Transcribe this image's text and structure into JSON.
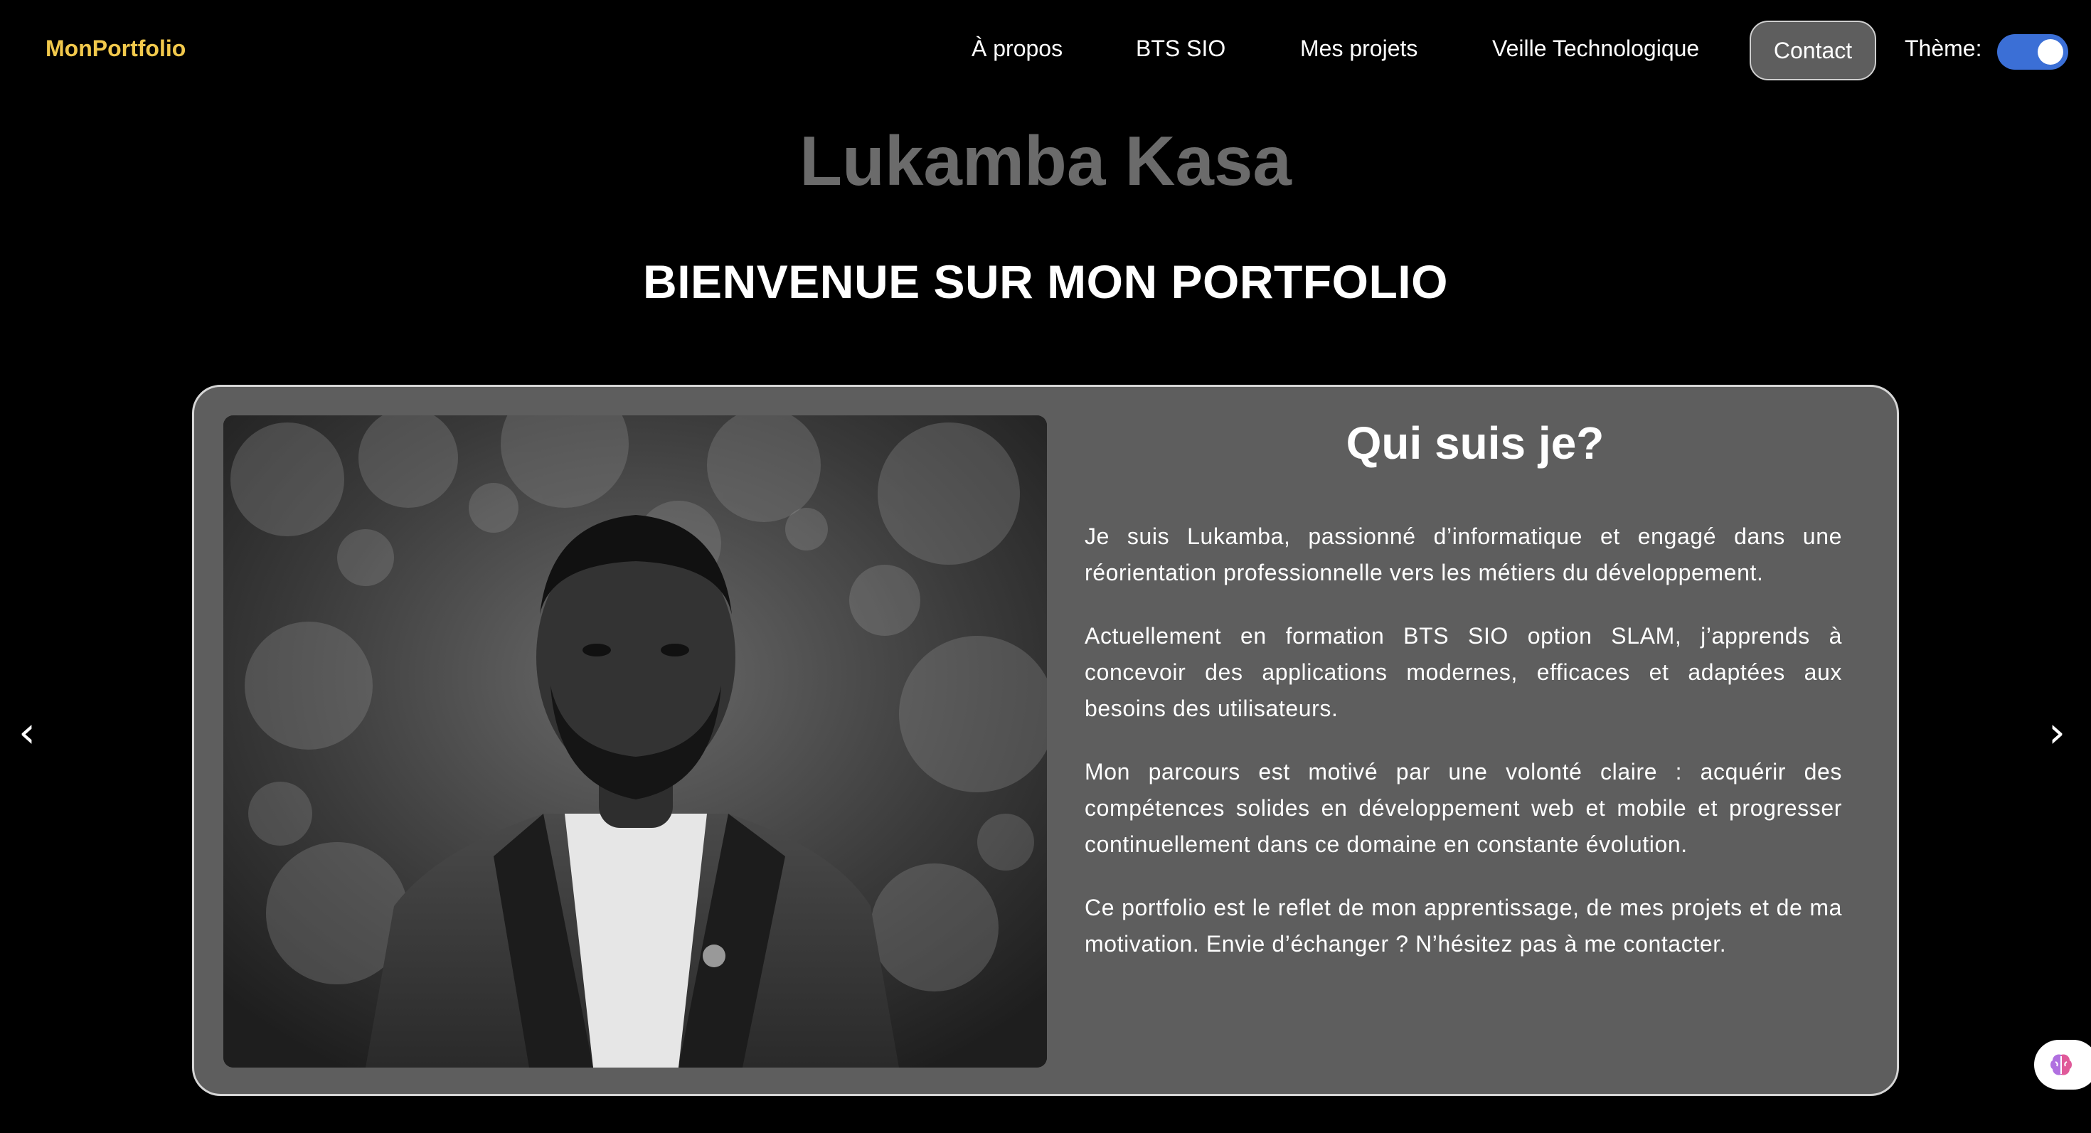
{
  "navbar": {
    "logo": "MonPortfolio",
    "links": [
      "À propos",
      "BTS SIO",
      "Mes projets",
      "Veille Technologique"
    ],
    "contact": "Contact",
    "theme_label": "Thème:",
    "theme_dark_enabled": true
  },
  "hero": {
    "name": "Lukamba Kasa",
    "subtitle": "BIENVENUE SUR MON PORTFOLIO"
  },
  "carousel": {
    "prev_arrow": "‹",
    "next_arrow": "›",
    "slide": {
      "title": "Qui suis je?",
      "paragraphs": [
        "Je suis Lukamba, passionné d’informatique et engagé dans une réorientation professionnelle vers les métiers du développement.",
        "Actuellement en formation BTS SIO option SLAM, j’apprends à concevoir des applications modernes, efficaces et adaptées aux besoins des utilisateurs.",
        "Mon parcours est motivé par une volonté claire : acquérir des compétences solides en développement web et mobile et progresser continuellement dans ce domaine en constante évolution.",
        "Ce portfolio est le reflet de mon apprentissage, de mes projets et de ma motivation. Envie d’échanger ? N’hésitez pas à me contacter."
      ]
    }
  },
  "colors": {
    "background": "#000000",
    "logo": "#f2c94c",
    "card": "#5e5e5e",
    "toggle": "#3b6fd6",
    "name": "#6b6b6b"
  },
  "icons": {
    "assistant": "brain-icon"
  }
}
